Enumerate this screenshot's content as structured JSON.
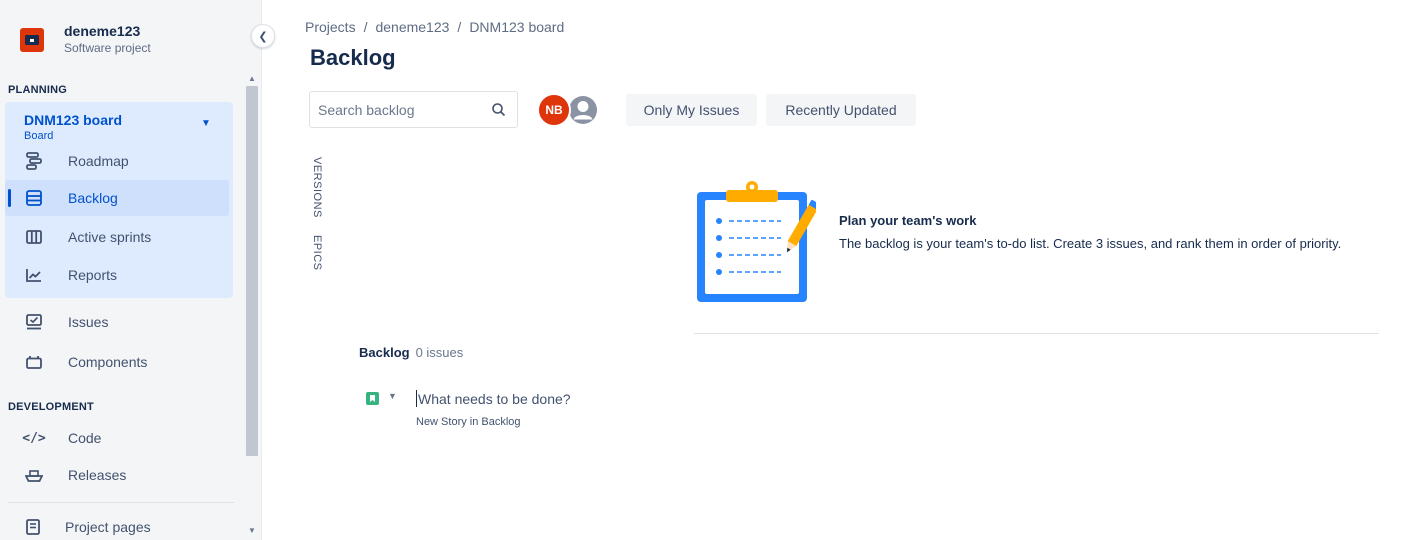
{
  "project": {
    "name": "deneme123",
    "type": "Software project"
  },
  "sidebar": {
    "planning_label": "PLANNING",
    "board": {
      "name": "DNM123 board",
      "sub": "Board"
    },
    "planning_items": [
      {
        "label": "Roadmap",
        "icon": "roadmap-icon"
      },
      {
        "label": "Backlog",
        "icon": "backlog-icon",
        "active": true
      },
      {
        "label": "Active sprints",
        "icon": "columns-icon"
      },
      {
        "label": "Reports",
        "icon": "chart-icon"
      }
    ],
    "other_items": [
      {
        "label": "Issues",
        "icon": "issues-icon"
      },
      {
        "label": "Components",
        "icon": "components-icon"
      }
    ],
    "development_label": "DEVELOPMENT",
    "development_items": [
      {
        "label": "Code",
        "icon": "code-icon"
      },
      {
        "label": "Releases",
        "icon": "ship-icon"
      }
    ],
    "footer_item": {
      "label": "Project pages",
      "icon": "page-icon"
    }
  },
  "breadcrumb": [
    "Projects",
    "deneme123",
    "DNM123 board"
  ],
  "page_title": "Backlog",
  "search": {
    "placeholder": "Search backlog",
    "value": ""
  },
  "avatars": [
    {
      "initials": "NB",
      "color": "#de350b"
    }
  ],
  "filters": [
    "Only My Issues",
    "Recently Updated"
  ],
  "side_tabs": [
    "VERSIONS",
    "EPICS"
  ],
  "empty_state": {
    "title": "Plan your team's work",
    "description": "The backlog is your team's to-do list. Create 3 issues, and rank them in order of priority."
  },
  "backlog": {
    "title": "Backlog",
    "count": "0 issues",
    "create_placeholder": "What needs to be done?",
    "create_hint": "New Story in Backlog"
  },
  "colors": {
    "accent": "#0052cc",
    "selected_bg": "#deebff",
    "story": "#36b37e",
    "avatar": "#de350b"
  }
}
